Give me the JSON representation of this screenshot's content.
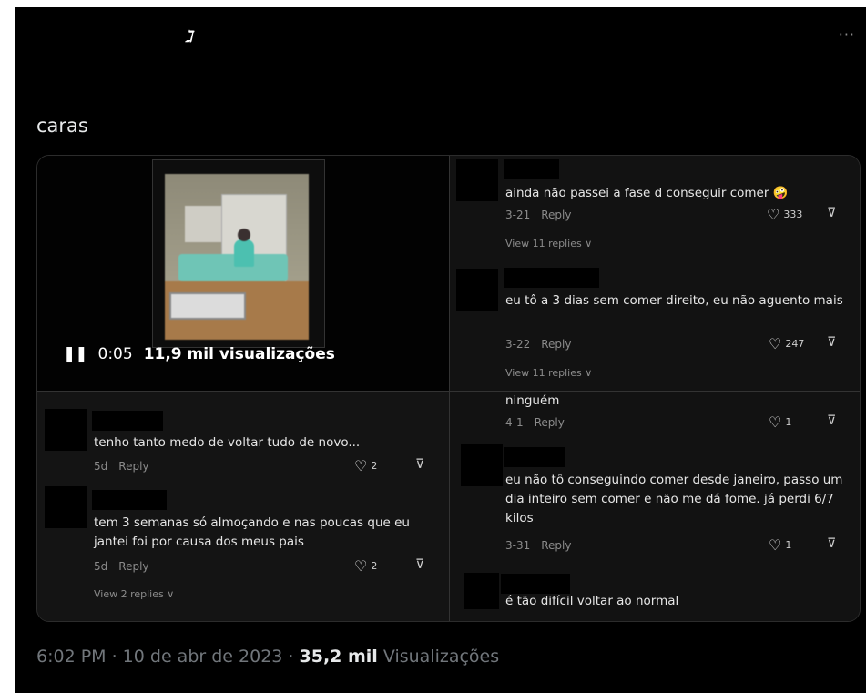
{
  "header": {
    "logo_glyph": "ℷ",
    "more_label": "···"
  },
  "tweet": {
    "text": "caras"
  },
  "video": {
    "pause_icon": "❚❚",
    "time": "0:05",
    "views": "11,9 mil visualizações"
  },
  "comments_tr": [
    {
      "text": "ainda não passei a fase d conseguir comer 🤪",
      "date": "3-21",
      "reply": "Reply",
      "likes": "333",
      "view_replies": "View 11 replies ∨"
    },
    {
      "text": "eu tô a 3 dias sem comer direito, eu não aguento mais",
      "date": "3-22",
      "reply": "Reply",
      "likes": "247",
      "view_replies": "View 11 replies ∨"
    }
  ],
  "comments_bl": [
    {
      "text": "tenho tanto medo de voltar tudo de novo...",
      "date": "5d",
      "reply": "Reply",
      "likes": "2"
    },
    {
      "text": "tem 3 semanas só almoçando e nas poucas que eu jantei foi por causa dos meus pais",
      "date": "5d",
      "reply": "Reply",
      "likes": "2",
      "view_replies": "View 2 replies ∨"
    }
  ],
  "comments_br": [
    {
      "text": "ninguém",
      "date": "4-1",
      "reply": "Reply",
      "likes": "1"
    },
    {
      "text": "eu não tô conseguindo comer desde janeiro, passo um dia inteiro sem comer e não me dá fome. já perdi 6/7 kilos",
      "date": "3-31",
      "reply": "Reply",
      "likes": "1"
    },
    {
      "text": "é tão difícil voltar ao normal"
    }
  ],
  "icons": {
    "heart": "♡",
    "dislike": "⊽"
  },
  "footer": {
    "time": "6:02 PM · 10 de abr de 2023 · ",
    "views_count": "35,2 mil",
    "views_label": " Visualizações"
  }
}
